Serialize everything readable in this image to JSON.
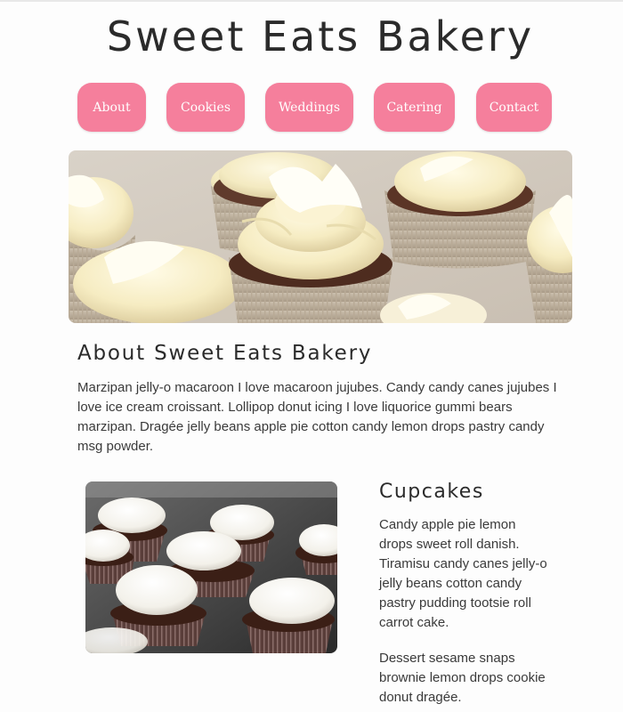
{
  "site": {
    "title": "Sweet Eats Bakery"
  },
  "nav": {
    "items": [
      {
        "label": "About"
      },
      {
        "label": "Cookies"
      },
      {
        "label": "Weddings"
      },
      {
        "label": "Catering"
      },
      {
        "label": "Contact"
      }
    ]
  },
  "about": {
    "heading": "About Sweet Eats Bakery",
    "body": "Marzipan jelly-o macaroon I love macaroon jujubes. Candy candy canes jujubes I love ice cream croissant. Lollipop donut icing I love liquorice gummi bears marzipan. Dragée jelly beans apple pie cotton candy lemon drops pastry candy msg powder."
  },
  "cupcakes": {
    "heading": "Cupcakes",
    "paragraphs": [
      "Candy apple pie lemon drops sweet roll danish. Tiramisu candy canes jelly-o jelly beans cotton candy pastry pudding tootsie roll carrot cake.",
      "Dessert sesame snaps brownie lemon drops cookie donut dragée."
    ]
  },
  "colors": {
    "nav_background": "#f57f9c",
    "nav_text": "#ffffff",
    "heading_text": "#2b2b2b",
    "body_text": "#3a3a3a"
  }
}
